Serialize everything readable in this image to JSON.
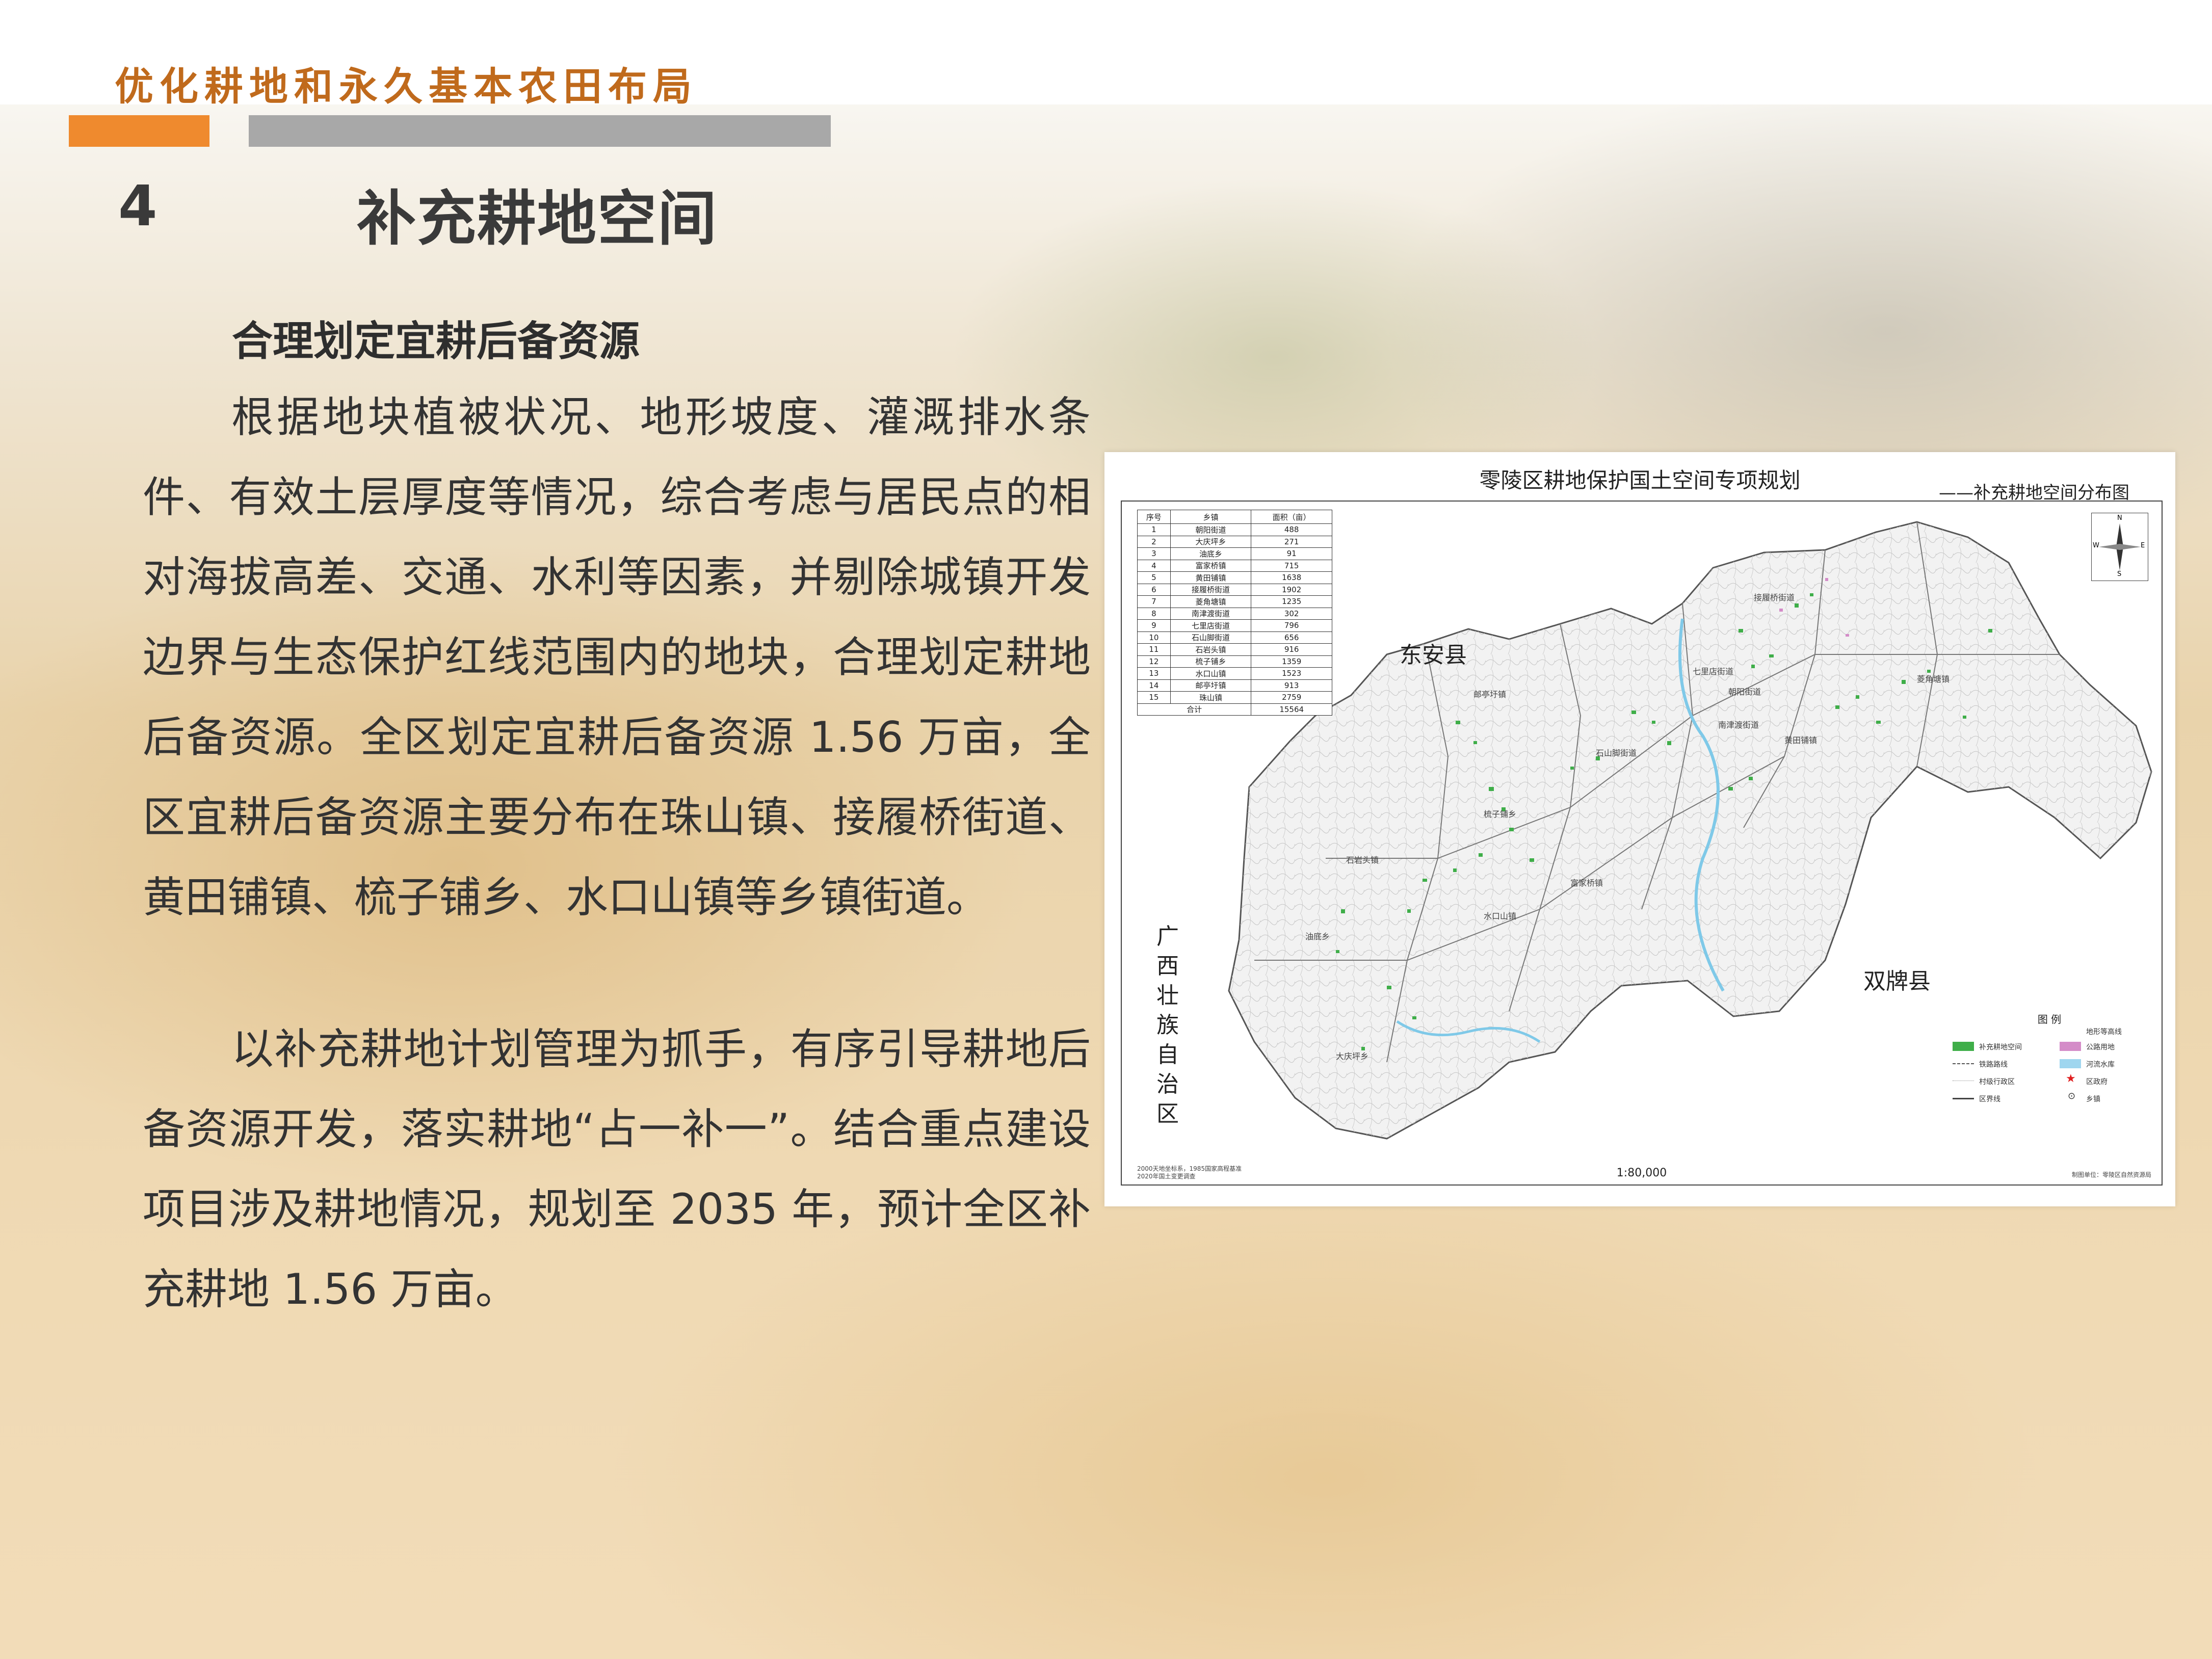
{
  "header": {
    "section_title": "优化耕地和永久基本农田布局"
  },
  "section": {
    "number": "4",
    "title": "补充耕地空间"
  },
  "content": {
    "subtitle": "合理划定宜耕后备资源",
    "paragraph1": "根据地块植被状况、地形坡度、灌溉排水条件、有效土层厚度等情况，综合考虑与居民点的相对海拔高差、交通、水利等因素，并剔除城镇开发边界与生态保护红线范围内的地块，合理划定耕地后备资源。全区划定宜耕后备资源 1.56 万亩，全区宜耕后备资源主要分布在珠山镇、接履桥街道、黄田铺镇、梳子铺乡、水口山镇等乡镇街道。",
    "paragraph2": "以补充耕地计划管理为抓手，有序引导耕地后备资源开发，落实耕地“占一补一”。结合重点建设项目涉及耕地情况，规划至 2035 年，预计全区补充耕地 1.56 万亩。"
  },
  "map": {
    "title": "零陵区耕地保护国土空间专项规划",
    "subtitle": "——补充耕地空间分布图",
    "table_headers": [
      "序号",
      "乡镇",
      "面积（亩）"
    ],
    "table_rows": [
      [
        "1",
        "朝阳街道",
        "488"
      ],
      [
        "2",
        "大庆坪乡",
        "271"
      ],
      [
        "3",
        "油底乡",
        "91"
      ],
      [
        "4",
        "富家桥镇",
        "715"
      ],
      [
        "5",
        "黄田铺镇",
        "1638"
      ],
      [
        "6",
        "接履桥街道",
        "1902"
      ],
      [
        "7",
        "菱角塘镇",
        "1235"
      ],
      [
        "8",
        "南津渡街道",
        "302"
      ],
      [
        "9",
        "七里店街道",
        "796"
      ],
      [
        "10",
        "石山脚街道",
        "656"
      ],
      [
        "11",
        "石岩头镇",
        "916"
      ],
      [
        "12",
        "梳子铺乡",
        "1359"
      ],
      [
        "13",
        "水口山镇",
        "1523"
      ],
      [
        "14",
        "邮亭圩镇",
        "913"
      ],
      [
        "15",
        "珠山镇",
        "2759"
      ],
      [
        "合计",
        "",
        "15564"
      ]
    ],
    "region_labels": {
      "east": "东安县",
      "southeast": "双牌县",
      "west": "广西壮族自治区"
    },
    "place_labels": [
      "接履桥街道",
      "黄田铺镇",
      "七里店街道",
      "石山脚街道",
      "梳子铺乡",
      "菱角塘镇",
      "邮亭圩镇",
      "富家桥镇",
      "水口山镇",
      "石岩头镇",
      "大庆坪乡",
      "南津渡街道",
      "朝阳街道",
      "油底乡"
    ],
    "compass_labels": {
      "n": "N",
      "s": "S",
      "e": "E",
      "w": "W"
    },
    "legend": {
      "title": "图 例",
      "items": [
        "补充耕地空间",
        "铁路路线",
        "村级行政区",
        "区界线",
        "地形等高线",
        "公路用地",
        "河流水库",
        "区政府",
        "乡镇"
      ],
      "colors": {
        "farmland": "#3fae49",
        "road": "#d48cc8",
        "water": "#9fd6ef",
        "gov": "#e02020"
      }
    },
    "scale": "1:80,000",
    "footnote_left": [
      "2000天地坐标系，1985国家高程基准",
      "2020年国土变更调查"
    ],
    "footnote_right": "制图单位：零陵区自然资源局"
  }
}
